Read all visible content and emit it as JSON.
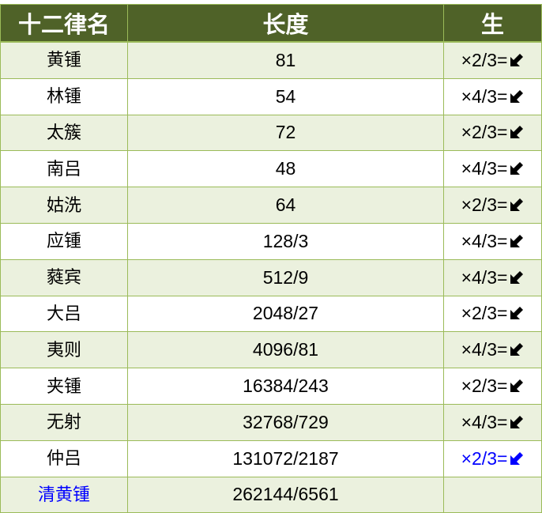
{
  "table": {
    "headers": [
      "十二律名",
      "长度",
      "生"
    ],
    "rows": [
      {
        "name": "黄锺",
        "length": "81",
        "op": "×2/3=",
        "arrow": "south-west-arrow-icon",
        "highlight": false
      },
      {
        "name": "林锺",
        "length": "54",
        "op": "×4/3=",
        "arrow": "south-west-arrow-icon",
        "highlight": false
      },
      {
        "name": "太簇",
        "length": "72",
        "op": "×2/3=",
        "arrow": "south-west-arrow-icon",
        "highlight": false
      },
      {
        "name": "南吕",
        "length": "48",
        "op": "×4/3=",
        "arrow": "south-west-arrow-icon",
        "highlight": false
      },
      {
        "name": "姑洗",
        "length": "64",
        "op": "×2/3=",
        "arrow": "south-west-arrow-icon",
        "highlight": false
      },
      {
        "name": "应锺",
        "length": "128/3",
        "op": "×4/3=",
        "arrow": "south-west-arrow-icon",
        "highlight": false
      },
      {
        "name": "蕤宾",
        "length": "512/9",
        "op": "×4/3=",
        "arrow": "south-west-arrow-icon",
        "highlight": false
      },
      {
        "name": "大吕",
        "length": "2048/27",
        "op": "×2/3=",
        "arrow": "south-west-arrow-icon",
        "highlight": false
      },
      {
        "name": "夷则",
        "length": "4096/81",
        "op": "×4/3=",
        "arrow": "south-west-arrow-icon",
        "highlight": false
      },
      {
        "name": "夹锺",
        "length": "16384/243",
        "op": "×2/3=",
        "arrow": "south-west-arrow-icon",
        "highlight": false
      },
      {
        "name": "无射",
        "length": "32768/729",
        "op": "×4/3=",
        "arrow": "south-west-arrow-icon",
        "highlight": false
      },
      {
        "name": "仲吕",
        "length": "131072/2187",
        "op": "×2/3=",
        "arrow": "south-west-arrow-icon",
        "highlight": "op"
      },
      {
        "name": "清黄锺",
        "length": "262144/6561",
        "op": "",
        "arrow": "",
        "highlight": "name"
      }
    ]
  },
  "colors": {
    "header_bg": "#4f6228",
    "header_text": "#ffffff",
    "row_alt_bg": "#ebf1de",
    "row_bg": "#ffffff",
    "border": "#9bbb59",
    "highlight_text": "#0000ff"
  }
}
